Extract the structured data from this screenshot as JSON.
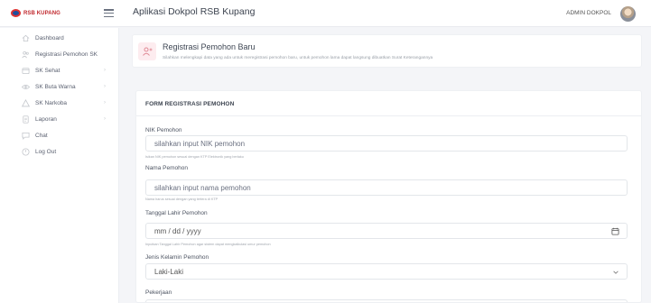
{
  "topbar": {
    "logo_text": "RSB KUPANG",
    "app_title": "Aplikasi Dokpol RSB Kupang",
    "user_name": "ADMIN DOKPOL"
  },
  "sidebar": {
    "items": [
      {
        "label": "Dashboard",
        "icon": "home-icon",
        "has_submenu": false
      },
      {
        "label": "Registrasi Pemohon SK",
        "icon": "users-icon",
        "has_submenu": false
      },
      {
        "label": "SK Sehat",
        "icon": "document-icon",
        "has_submenu": true
      },
      {
        "label": "SK Buta Warna",
        "icon": "eye-icon",
        "has_submenu": true
      },
      {
        "label": "SK Narkoba",
        "icon": "warning-icon",
        "has_submenu": true
      },
      {
        "label": "Laporan",
        "icon": "report-icon",
        "has_submenu": true
      },
      {
        "label": "Chat",
        "icon": "chat-icon",
        "has_submenu": false
      },
      {
        "label": "Log Out",
        "icon": "power-icon",
        "has_submenu": false
      }
    ],
    "chevron": "›"
  },
  "header": {
    "title": "Registrasi Pemohon Baru",
    "description": "Silahkan melengkapi data yang ada untuk meregistrasi pemohon baru, untuk pemohon lama dapat langsung dibuatkan Surat Keterangannya"
  },
  "form": {
    "title": "FORM REGISTRASI PEMOHON",
    "nik": {
      "label": "NIK Pemohon",
      "placeholder": "silahkan input NIK pemohon",
      "help": "Isikan NIK pemohon sesuai dengan KTP Elektronik yang berlaku"
    },
    "nama": {
      "label": "Nama Pemohon",
      "placeholder": "silahkan input nama pemohon",
      "help": "Nama harus sesuai dengan yang tertera di KTP"
    },
    "tanggal_lahir": {
      "label": "Tanggal Lahir Pemohon",
      "placeholder": "mm / dd / yyyy",
      "help": "Inputkan Tanggal Lahir Pemohon agar sistem dapat mengkalkulasi umur pemohon"
    },
    "jenis_kelamin": {
      "label": "Jenis Kelamin Pemohon",
      "selected": "Laki-Laki"
    },
    "pekerjaan": {
      "label": "Pekerjaan"
    }
  },
  "colors": {
    "brand_red": "#c0282d",
    "brand_blue": "#1f4e9c",
    "header_icon_bg": "#fdecef",
    "header_icon_fg": "#e08a96"
  }
}
